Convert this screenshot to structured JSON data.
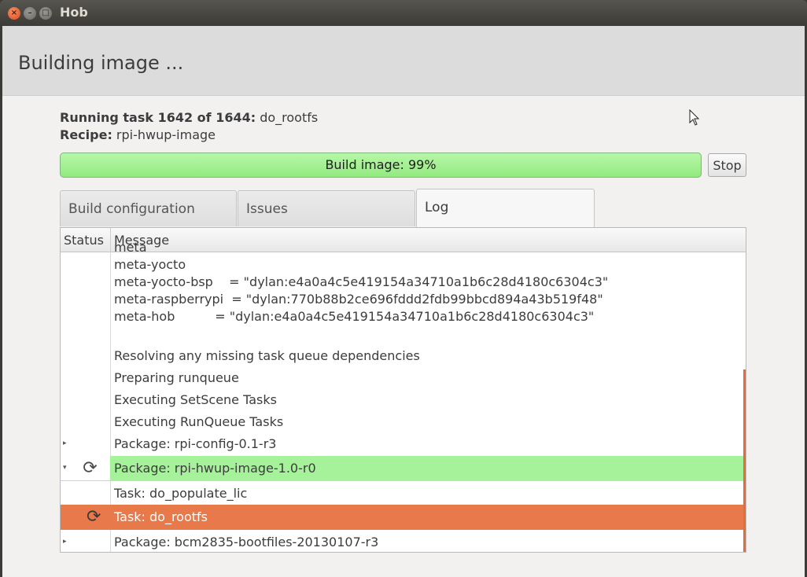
{
  "window": {
    "title": "Hob"
  },
  "header": {
    "title": "Building image ..."
  },
  "status": {
    "running_label": "Running task 1642 of 1644:",
    "running_task": " do_rootfs",
    "recipe_label": "Recipe:",
    "recipe_value": " rpi-hwup-image"
  },
  "progress": {
    "label": "Build image:  99%",
    "percent": 99
  },
  "stop_label": "Stop",
  "tabs": [
    {
      "label": "Build configuration"
    },
    {
      "label": "Issues"
    },
    {
      "label": "Log"
    }
  ],
  "log": {
    "col_status": "Status",
    "col_message": "Message",
    "partial_top": "meta",
    "lines": [
      "meta-yocto",
      "meta-yocto-bsp    = \"dylan:e4a0a4c5e419154a34710a1b6c28d4180c6304c3\"",
      "meta-raspberrypi  = \"dylan:770b88b2ce696fddd2fdb99bbcd894a43b519f48\"",
      "meta-hob          = \"dylan:e4a0a4c5e419154a34710a1b6c28d4180c6304c3\""
    ],
    "rows": [
      {
        "message": "Resolving any missing task queue dependencies"
      },
      {
        "message": "Preparing runqueue"
      },
      {
        "message": "Executing SetScene Tasks"
      },
      {
        "message": "Executing RunQueue Tasks"
      },
      {
        "message": "Package: rpi-config-0.1-r3",
        "expander": "▸"
      },
      {
        "message": "Package: rpi-hwup-image-1.0-r0",
        "expander": "▾",
        "icon": "refresh-icon",
        "highlight": "#a6f29b"
      },
      {
        "message": "Task: do_populate_lic"
      },
      {
        "message": "Task: do_rootfs",
        "icon": "refresh-icon",
        "highlight": "#e8794a"
      },
      {
        "message": "Package: bcm2835-bootfiles-20130107-r3",
        "expander": "▸"
      }
    ]
  },
  "icons": {
    "refresh": "⟳",
    "expand": "▸",
    "collapse": "▾"
  },
  "colors": {
    "progress_green": "#93ea80",
    "running_row_green": "#a6f29b",
    "active_task_orange": "#e8794a"
  }
}
